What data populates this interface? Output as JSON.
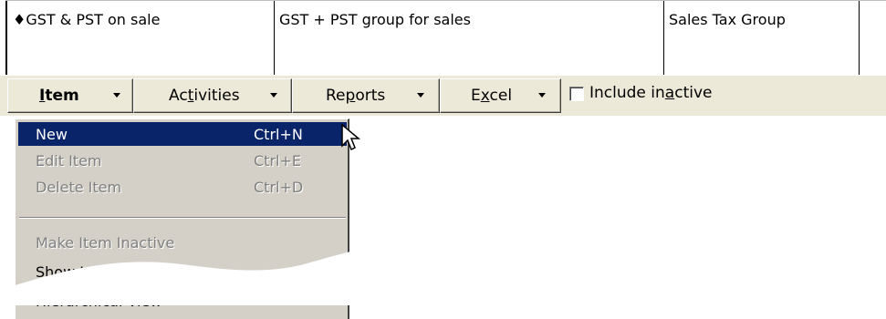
{
  "table": {
    "row": {
      "name": "♦GST & PST on sale",
      "description": "GST + PST group for sales",
      "type": "Sales Tax Group"
    }
  },
  "toolbar": {
    "item_label": "Item",
    "activities_label": "Activities",
    "reports_label": "Reports",
    "excel_label": "Excel",
    "include_inactive_label": "Include inactive",
    "include_inactive_checked": false
  },
  "menu": {
    "items": [
      {
        "label": "New",
        "shortcut": "Ctrl+N",
        "state": "selected"
      },
      {
        "label": "Edit Item",
        "shortcut": "Ctrl+E",
        "state": "disabled"
      },
      {
        "label": "Delete Item",
        "shortcut": "Ctrl+D",
        "state": "disabled"
      },
      {
        "label": "Make Item Inactive",
        "shortcut": "",
        "state": "disabled"
      },
      {
        "label": "Show Inactive Items",
        "shortcut": "",
        "state": "enabled"
      },
      {
        "label": "Hierarchical View",
        "shortcut": "",
        "state": "checked"
      }
    ]
  },
  "colors": {
    "selection": "#0a246a",
    "toolbar_bg": "#ece9d8",
    "menu_bg": "#d4d0c8",
    "disabled_text": "#808080"
  }
}
